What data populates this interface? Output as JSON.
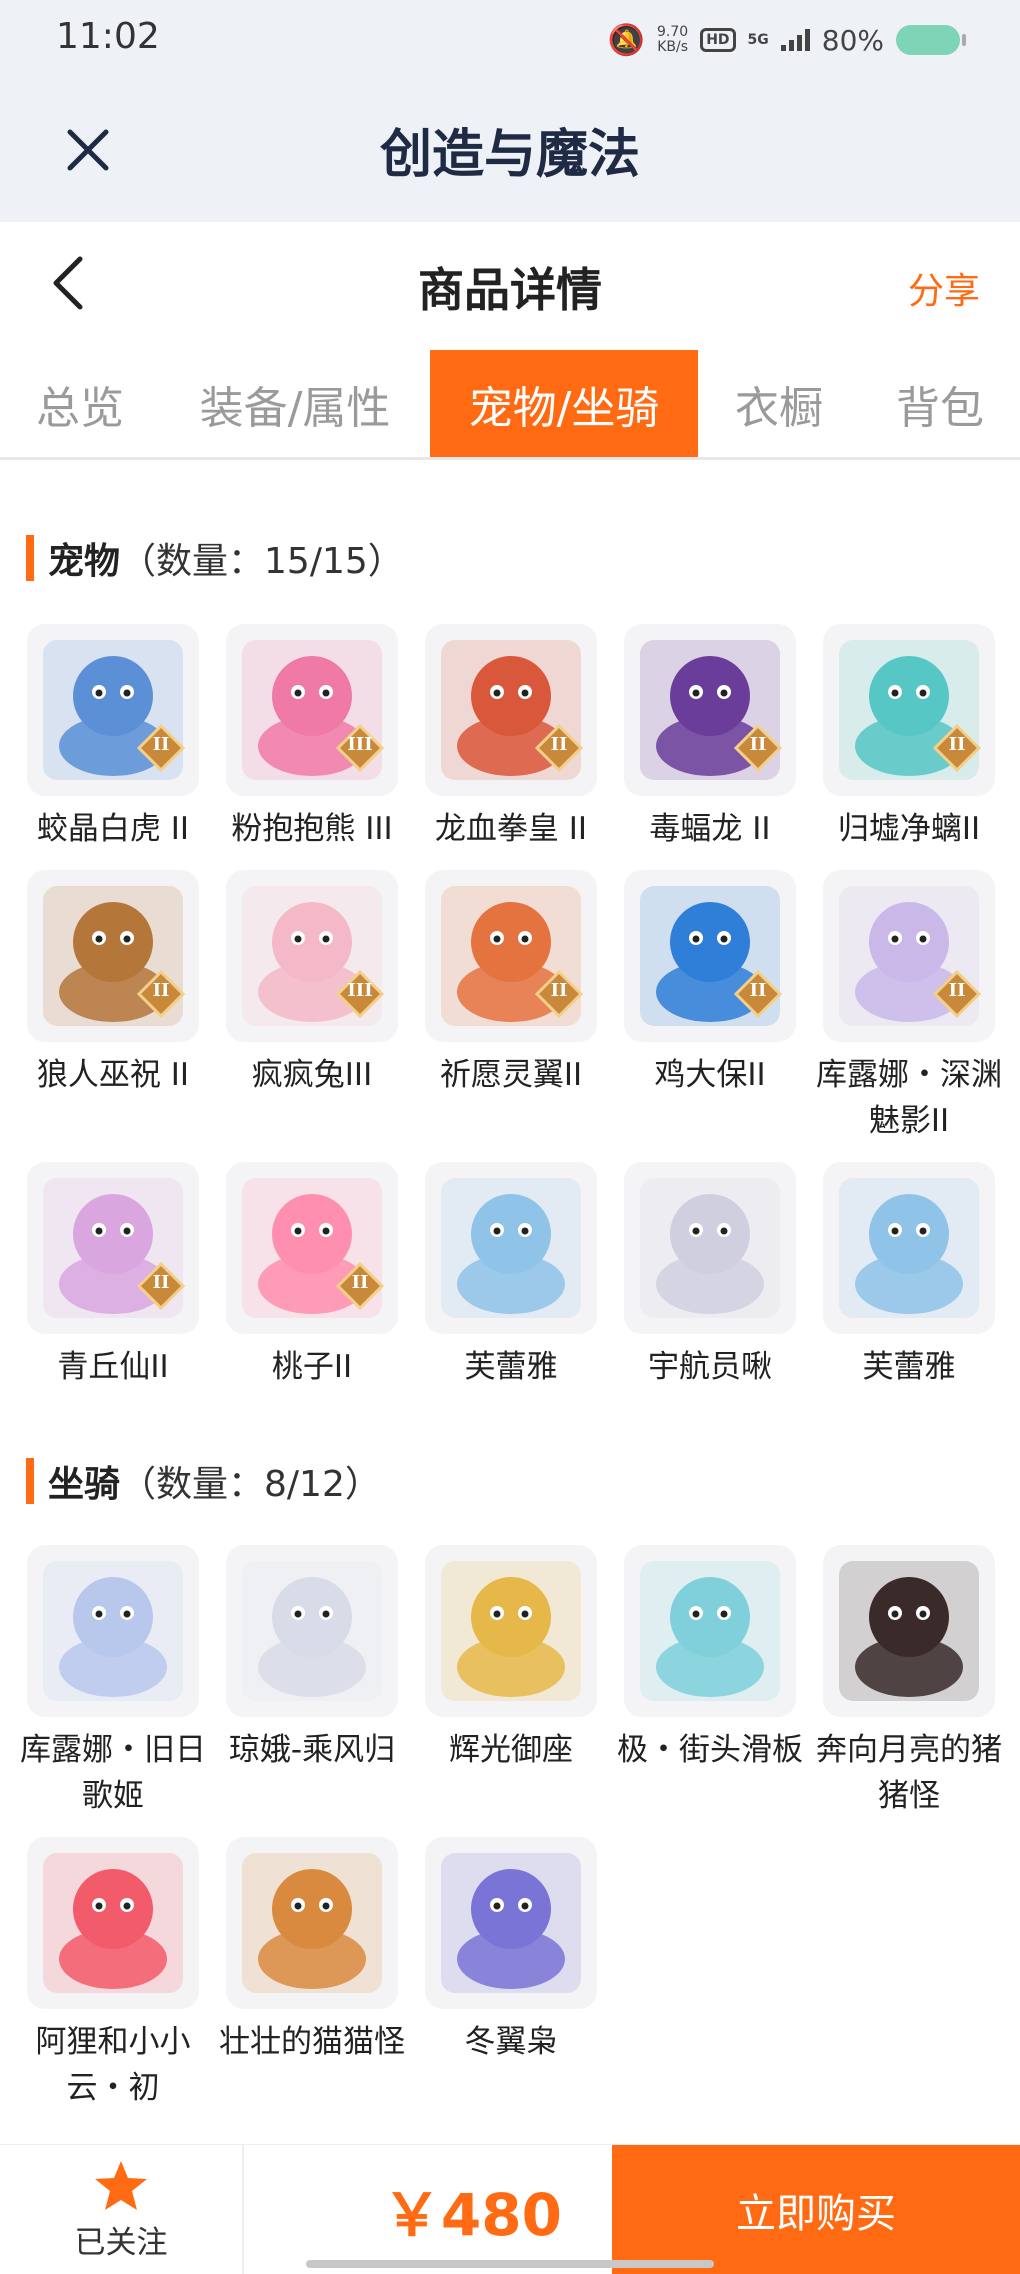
{
  "status": {
    "time": "11:02",
    "netspeed_value": "9.70",
    "netspeed_unit": "KB/s",
    "hd": "HD",
    "network": "5G",
    "battery": "80%",
    "battery_level": 0.8
  },
  "app": {
    "title": "创造与魔法"
  },
  "header": {
    "title": "商品详情",
    "share": "分享"
  },
  "tabs": [
    {
      "label": "总览",
      "active": false
    },
    {
      "label": "装备/属性",
      "active": false
    },
    {
      "label": "宠物/坐骑",
      "active": true
    },
    {
      "label": "衣橱",
      "active": false
    },
    {
      "label": "背包",
      "active": false
    }
  ],
  "pets": {
    "name": "宠物",
    "count": "（数量：15/15）",
    "items": [
      {
        "label": "蛟晶白虎 II",
        "icon": "white-tiger-icon",
        "color": "#5b8fd6",
        "badge": "II"
      },
      {
        "label": "粉抱抱熊 III",
        "icon": "pink-bear-icon",
        "color": "#f07aa6",
        "badge": "III"
      },
      {
        "label": "龙血拳皇 II",
        "icon": "dragon-fist-icon",
        "color": "#d9573a",
        "badge": "II"
      },
      {
        "label": "毒蝠龙 II",
        "icon": "poison-bat-dragon-icon",
        "color": "#6a3d9a",
        "badge": "II"
      },
      {
        "label": "归墟净螭II",
        "icon": "jade-serpent-icon",
        "color": "#56c7c4",
        "badge": "II"
      },
      {
        "label": "狼人巫祝 II",
        "icon": "werewolf-shaman-icon",
        "color": "#b5763a",
        "badge": "II"
      },
      {
        "label": "疯疯兔III",
        "icon": "crazy-rabbit-icon",
        "color": "#f4b8c8",
        "badge": "III"
      },
      {
        "label": "祈愿灵翼II",
        "icon": "wish-wing-bird-icon",
        "color": "#e5733f",
        "badge": "II"
      },
      {
        "label": "鸡大保II",
        "icon": "chicken-boss-icon",
        "color": "#2f7fd8",
        "badge": "II"
      },
      {
        "label": "库露娜・深渊魅影II",
        "icon": "kuluna-abyss-icon",
        "color": "#c9b8e8",
        "badge": "II"
      },
      {
        "label": "青丘仙II",
        "icon": "qingqiu-fairy-icon",
        "color": "#d9a6e0",
        "badge": "II"
      },
      {
        "label": "桃子II",
        "icon": "peach-cat-icon",
        "color": "#ff8fae",
        "badge": "II"
      },
      {
        "label": "芙蕾雅",
        "icon": "freya-icon",
        "color": "#8fc3e8",
        "badge": ""
      },
      {
        "label": "宇航员啾",
        "icon": "astronaut-cow-icon",
        "color": "#cfcfe0",
        "badge": ""
      },
      {
        "label": "芙蕾雅",
        "icon": "freya-icon",
        "color": "#8fc3e8",
        "badge": ""
      }
    ]
  },
  "mounts": {
    "name": "坐骑",
    "count": "（数量：8/12）",
    "items": [
      {
        "label": "库露娜・旧日歌姬",
        "icon": "kuluna-singer-icon",
        "color": "#b8c8ec",
        "badge": ""
      },
      {
        "label": "琼娥-乘风归",
        "icon": "qiong-e-icon",
        "color": "#d8dbe8",
        "badge": ""
      },
      {
        "label": "辉光御座",
        "icon": "glow-throne-icon",
        "color": "#e6b84a",
        "badge": ""
      },
      {
        "label": "极・街头滑板",
        "icon": "skateboard-icon",
        "color": "#7fd0da",
        "badge": ""
      },
      {
        "label": "奔向月亮的猪猪怪",
        "icon": "moon-pig-icon",
        "color": "#3a2a2a",
        "badge": ""
      },
      {
        "label": "阿狸和小小云・初",
        "icon": "ali-cloud-icon",
        "color": "#f25b6a",
        "badge": ""
      },
      {
        "label": "壮壮的猫猫怪",
        "icon": "chubby-cat-icon",
        "color": "#d98a3f",
        "badge": ""
      },
      {
        "label": "冬翼枭",
        "icon": "winter-owl-icon",
        "color": "#7a74d6",
        "badge": ""
      }
    ]
  },
  "bottom": {
    "follow_label": "已关注",
    "price": "￥480",
    "buy": "立即购买"
  },
  "colors": {
    "accent": "#ff6a13",
    "header_bg": "#eef2f6",
    "title_dark": "#1f2a44"
  }
}
